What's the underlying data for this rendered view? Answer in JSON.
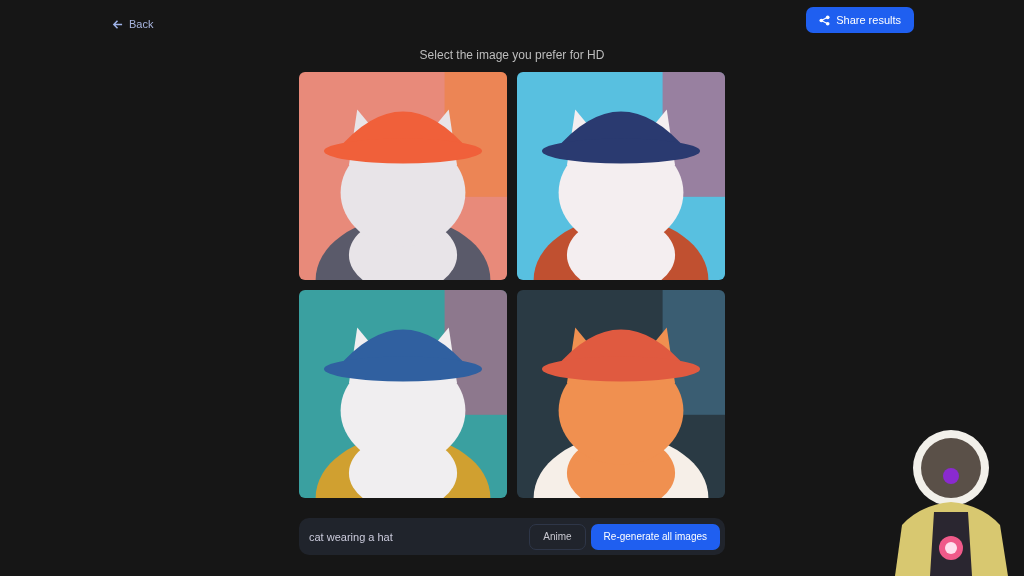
{
  "top_bar": {
    "back_link": "Back",
    "share_button": "Share results"
  },
  "heading": "Select the image you prefer for HD",
  "prompt_bar": {
    "prompt": "cat wearing a hat",
    "style_button": "Anime",
    "regenerate_button": "Re-generate all images"
  }
}
